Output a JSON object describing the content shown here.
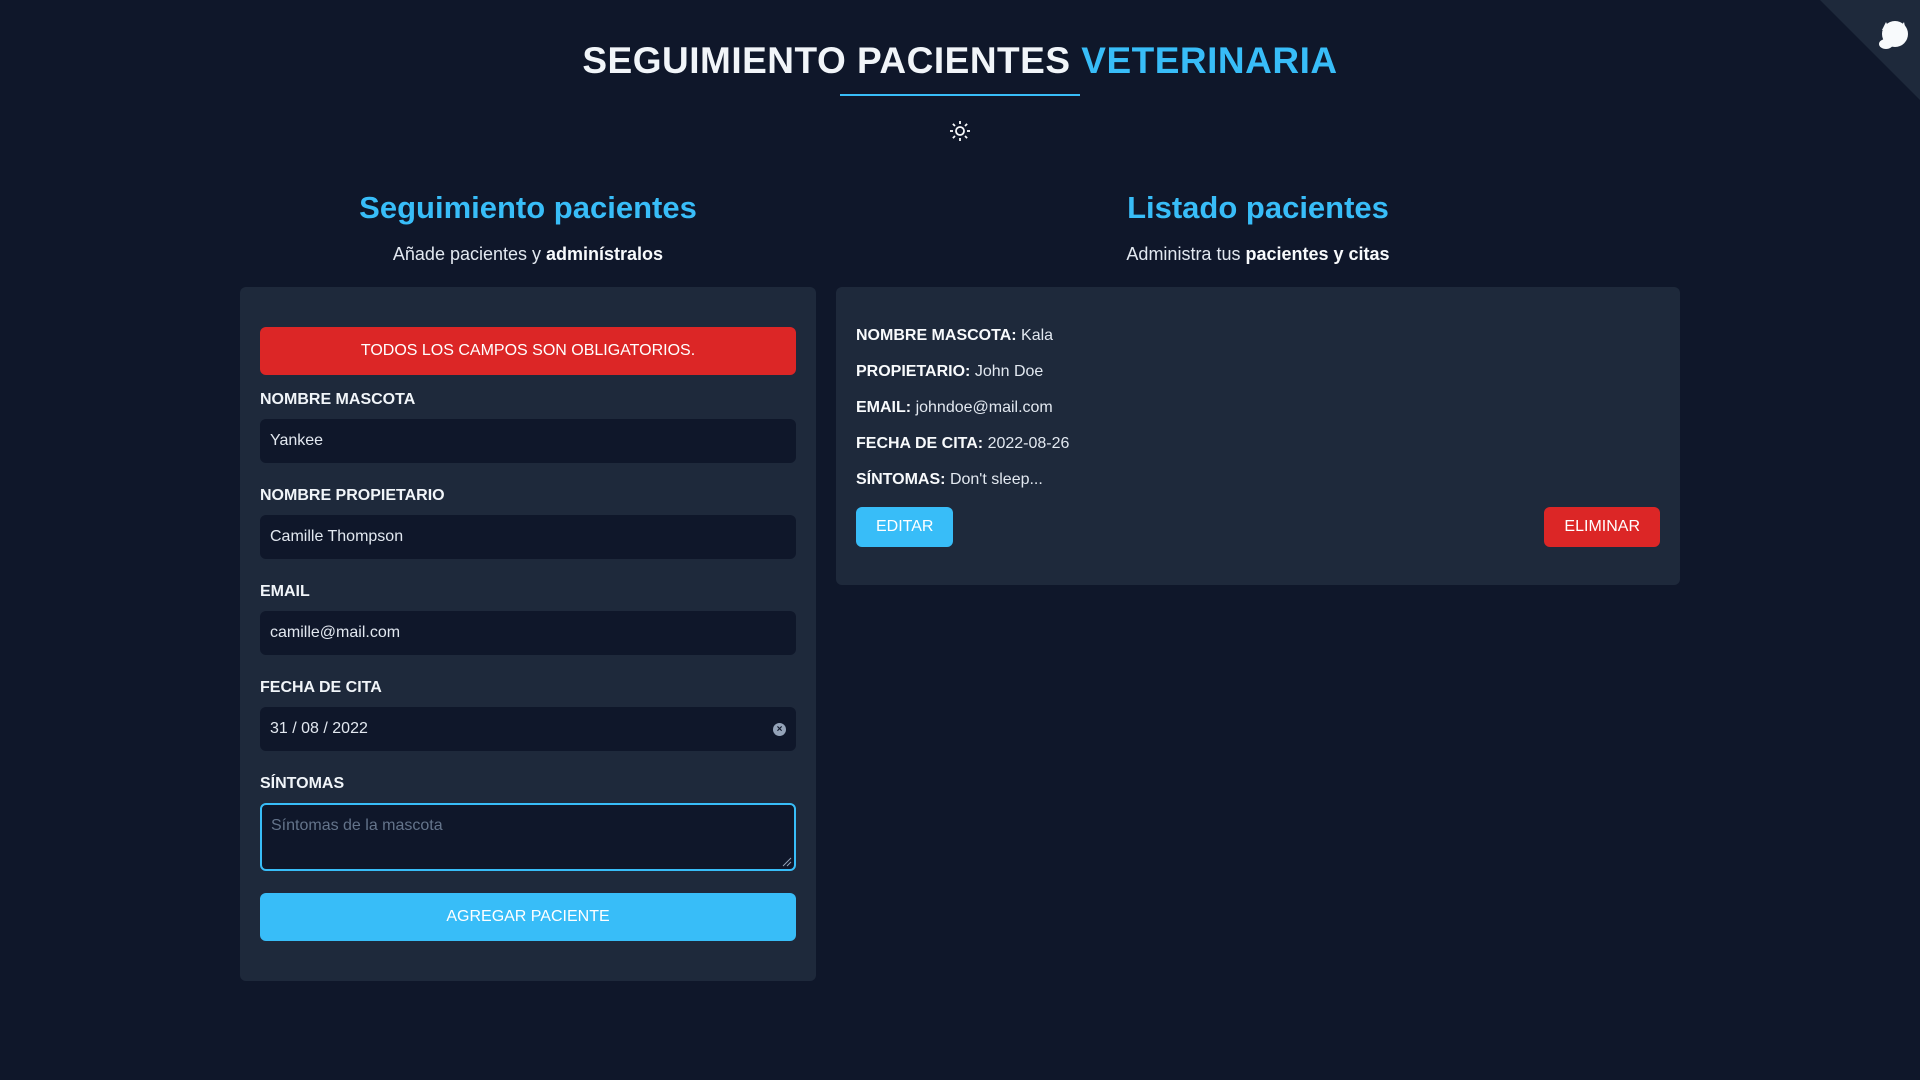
{
  "header": {
    "title_main": "SEGUIMIENTO PACIENTES",
    "title_accent": "VETERINARIA",
    "theme_icon": "sun-icon",
    "corner_icon": "github-octocat-icon"
  },
  "form_section": {
    "title": "Seguimiento pacientes",
    "subtitle_plain": "Añade pacientes y",
    "subtitle_bold": "adminístralos",
    "alert": "TODOS LOS CAMPOS SON OBLIGATORIOS.",
    "fields": {
      "pet_name": {
        "label": "NOMBRE MASCOTA",
        "value": "Yankee"
      },
      "owner_name": {
        "label": "NOMBRE PROPIETARIO",
        "value": "Camille Thompson"
      },
      "email": {
        "label": "EMAIL",
        "value": "camille@mail.com"
      },
      "date": {
        "label": "FECHA DE CITA",
        "value": "31 / 08 / 2022"
      },
      "symptoms": {
        "label": "SÍNTOMAS",
        "placeholder": "Síntomas de la mascota"
      }
    },
    "submit_label": "AGREGAR PACIENTE"
  },
  "list_section": {
    "title": "Listado pacientes",
    "subtitle_plain": "Administra tus",
    "subtitle_bold": "pacientes y citas",
    "patient": {
      "pet_label": "NOMBRE MASCOTA:",
      "pet_value": "Kala",
      "owner_label": "PROPIETARIO:",
      "owner_value": "John Doe",
      "email_label": "EMAIL:",
      "email_value": "johndoe@mail.com",
      "date_label": "FECHA DE CITA:",
      "date_value": "2022-08-26",
      "symptoms_label": "SÍNTOMAS:",
      "symptoms_value": "Don't sleep..."
    },
    "edit_label": "EDITAR",
    "delete_label": "ELIMINAR"
  },
  "colors": {
    "background": "#0f172a",
    "panel": "#1e293b",
    "accent": "#38bdf8",
    "danger": "#dc2626"
  }
}
